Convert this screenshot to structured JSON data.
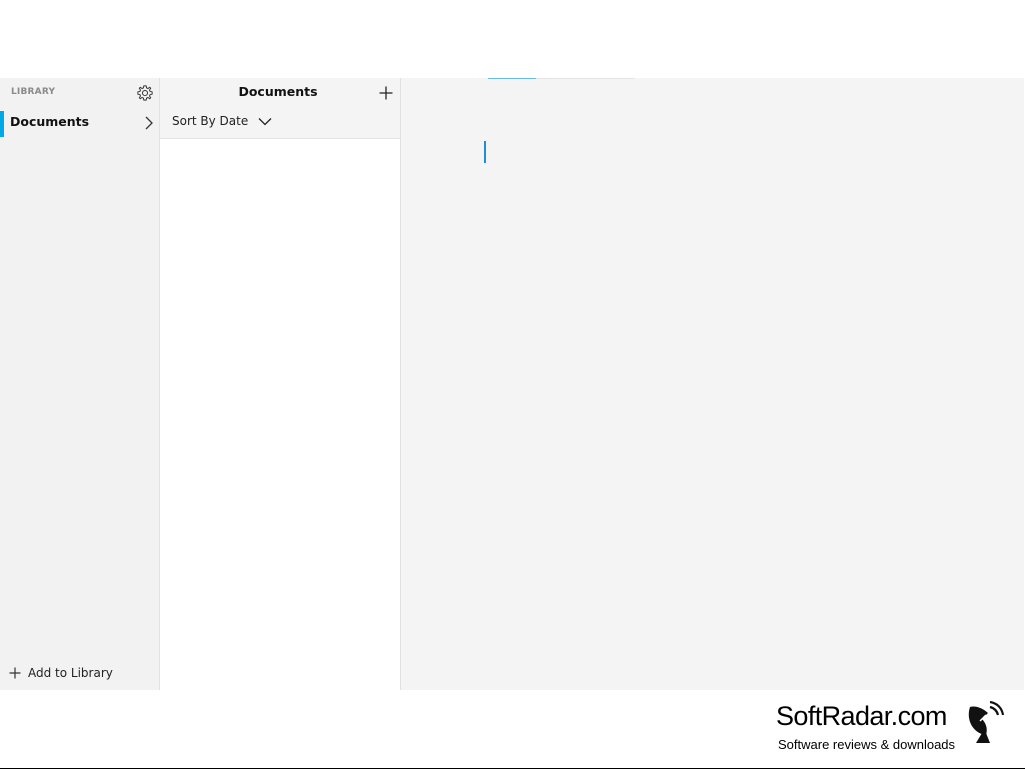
{
  "library": {
    "header": "LIBRARY",
    "settings_icon": "gear-icon",
    "items": [
      {
        "label": "Documents",
        "selected": true
      }
    ],
    "add_label": "Add to Library"
  },
  "documents": {
    "title": "Documents",
    "add_icon": "plus-icon",
    "sort_label": "Sort By Date",
    "items": []
  },
  "editor": {
    "content": ""
  },
  "watermark": {
    "title": "SoftRadar.com",
    "subtitle": "Software reviews & downloads"
  },
  "colors": {
    "accent": "#00a8e8",
    "sidebar_bg": "#f2f2f2",
    "editor_bg": "#f4f4f4",
    "caret": "#1a90d9"
  }
}
